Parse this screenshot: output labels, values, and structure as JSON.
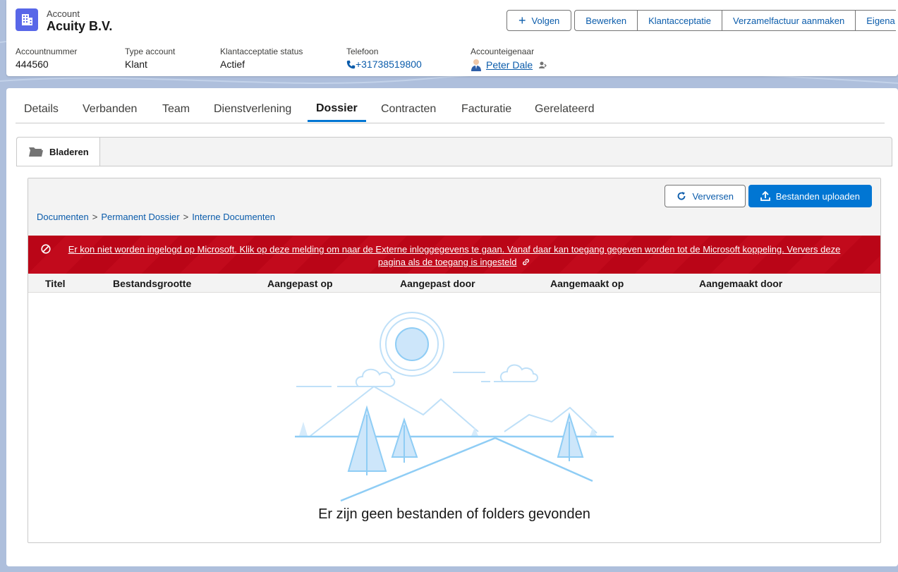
{
  "header": {
    "kicker": "Account",
    "name": "Acuity B.V.",
    "actions": {
      "follow": "Volgen",
      "edit": "Bewerken",
      "acceptance": "Klantacceptatie",
      "invoice": "Verzamelfactuur aanmaken",
      "owner_change": "Eigena"
    },
    "fields": [
      {
        "label": "Accountnummer",
        "value": "444560"
      },
      {
        "label": "Type account",
        "value": "Klant"
      },
      {
        "label": "Klantacceptatie status",
        "value": "Actief"
      },
      {
        "label": "Telefoon",
        "value": "+31738519800"
      },
      {
        "label": "Accounteigenaar",
        "value": "Peter Dale"
      }
    ]
  },
  "tabs": [
    "Details",
    "Verbanden",
    "Team",
    "Dienstverlening",
    "Dossier",
    "Contracten",
    "Facturatie",
    "Gerelateerd"
  ],
  "active_tab": "Dossier",
  "browser": {
    "tab_label": "Bladeren",
    "refresh": "Verversen",
    "upload": "Bestanden uploaden",
    "breadcrumbs": [
      "Documenten",
      "Permanent Dossier",
      "Interne Documenten"
    ],
    "breadcrumb_separator": ">",
    "error_line1": "Er kon niet worden ingelogd op Microsoft. Klik op deze melding om naar de Externe inloggegevens te gaan. Vanaf daar kan toegang gegeven worden tot de Microsoft koppeling. Ververs deze",
    "error_line2": "pagina als de toegang is ingesteld",
    "columns": [
      "Titel",
      "Bestandsgrootte",
      "Aangepast op",
      "Aangepast door",
      "Aangemaakt op",
      "Aangemaakt door"
    ],
    "empty_message": "Er zijn geen bestanden of folders gevonden"
  },
  "colors": {
    "brand": "#0176d3",
    "error": "#ba0517",
    "account_icon": "#5867e8"
  }
}
